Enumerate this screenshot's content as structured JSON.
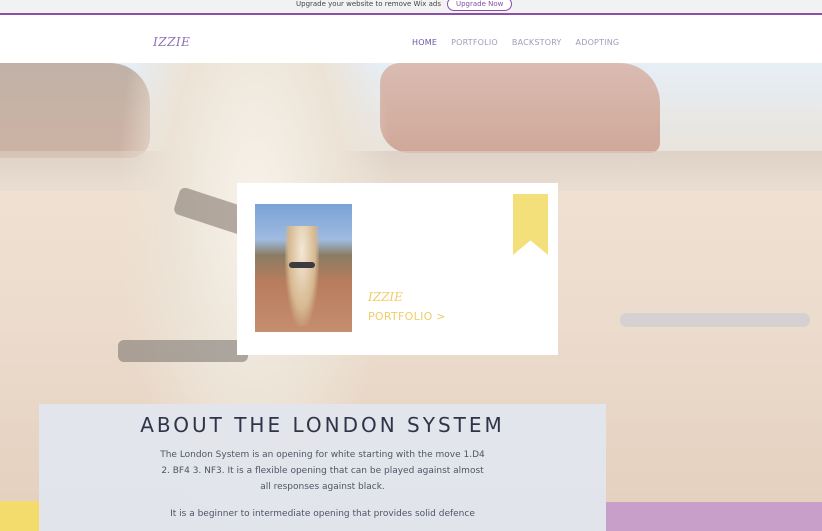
{
  "promo": {
    "text": "Upgrade your website to remove Wix ads",
    "button_label": "Upgrade Now"
  },
  "site": {
    "logo": "IZZIE",
    "nav": [
      {
        "label": "HOME",
        "active": true
      },
      {
        "label": "PORTFOLIO",
        "active": false
      },
      {
        "label": "BACKSTORY",
        "active": false
      },
      {
        "label": "ADOPTING",
        "active": false
      }
    ]
  },
  "card": {
    "name": "IZZIE",
    "link_label": "PORTFOLIO >",
    "accent_color": "#f1cd66"
  },
  "about": {
    "title": "ABOUT THE LONDON SYSTEM",
    "paragraph1": "The London System is an opening for white starting with the move 1.D4 2. BF4 3. NF3. It is a flexible opening that can be played against almost all responses against black.",
    "paragraph2": "It is a beginner to intermediate opening that provides solid defence"
  },
  "colors": {
    "brand_purple": "#8a4fa6",
    "nav_active": "#6e55a3",
    "bookmark_yellow": "#f4e07a",
    "strip_purple": "#c79fc8"
  }
}
